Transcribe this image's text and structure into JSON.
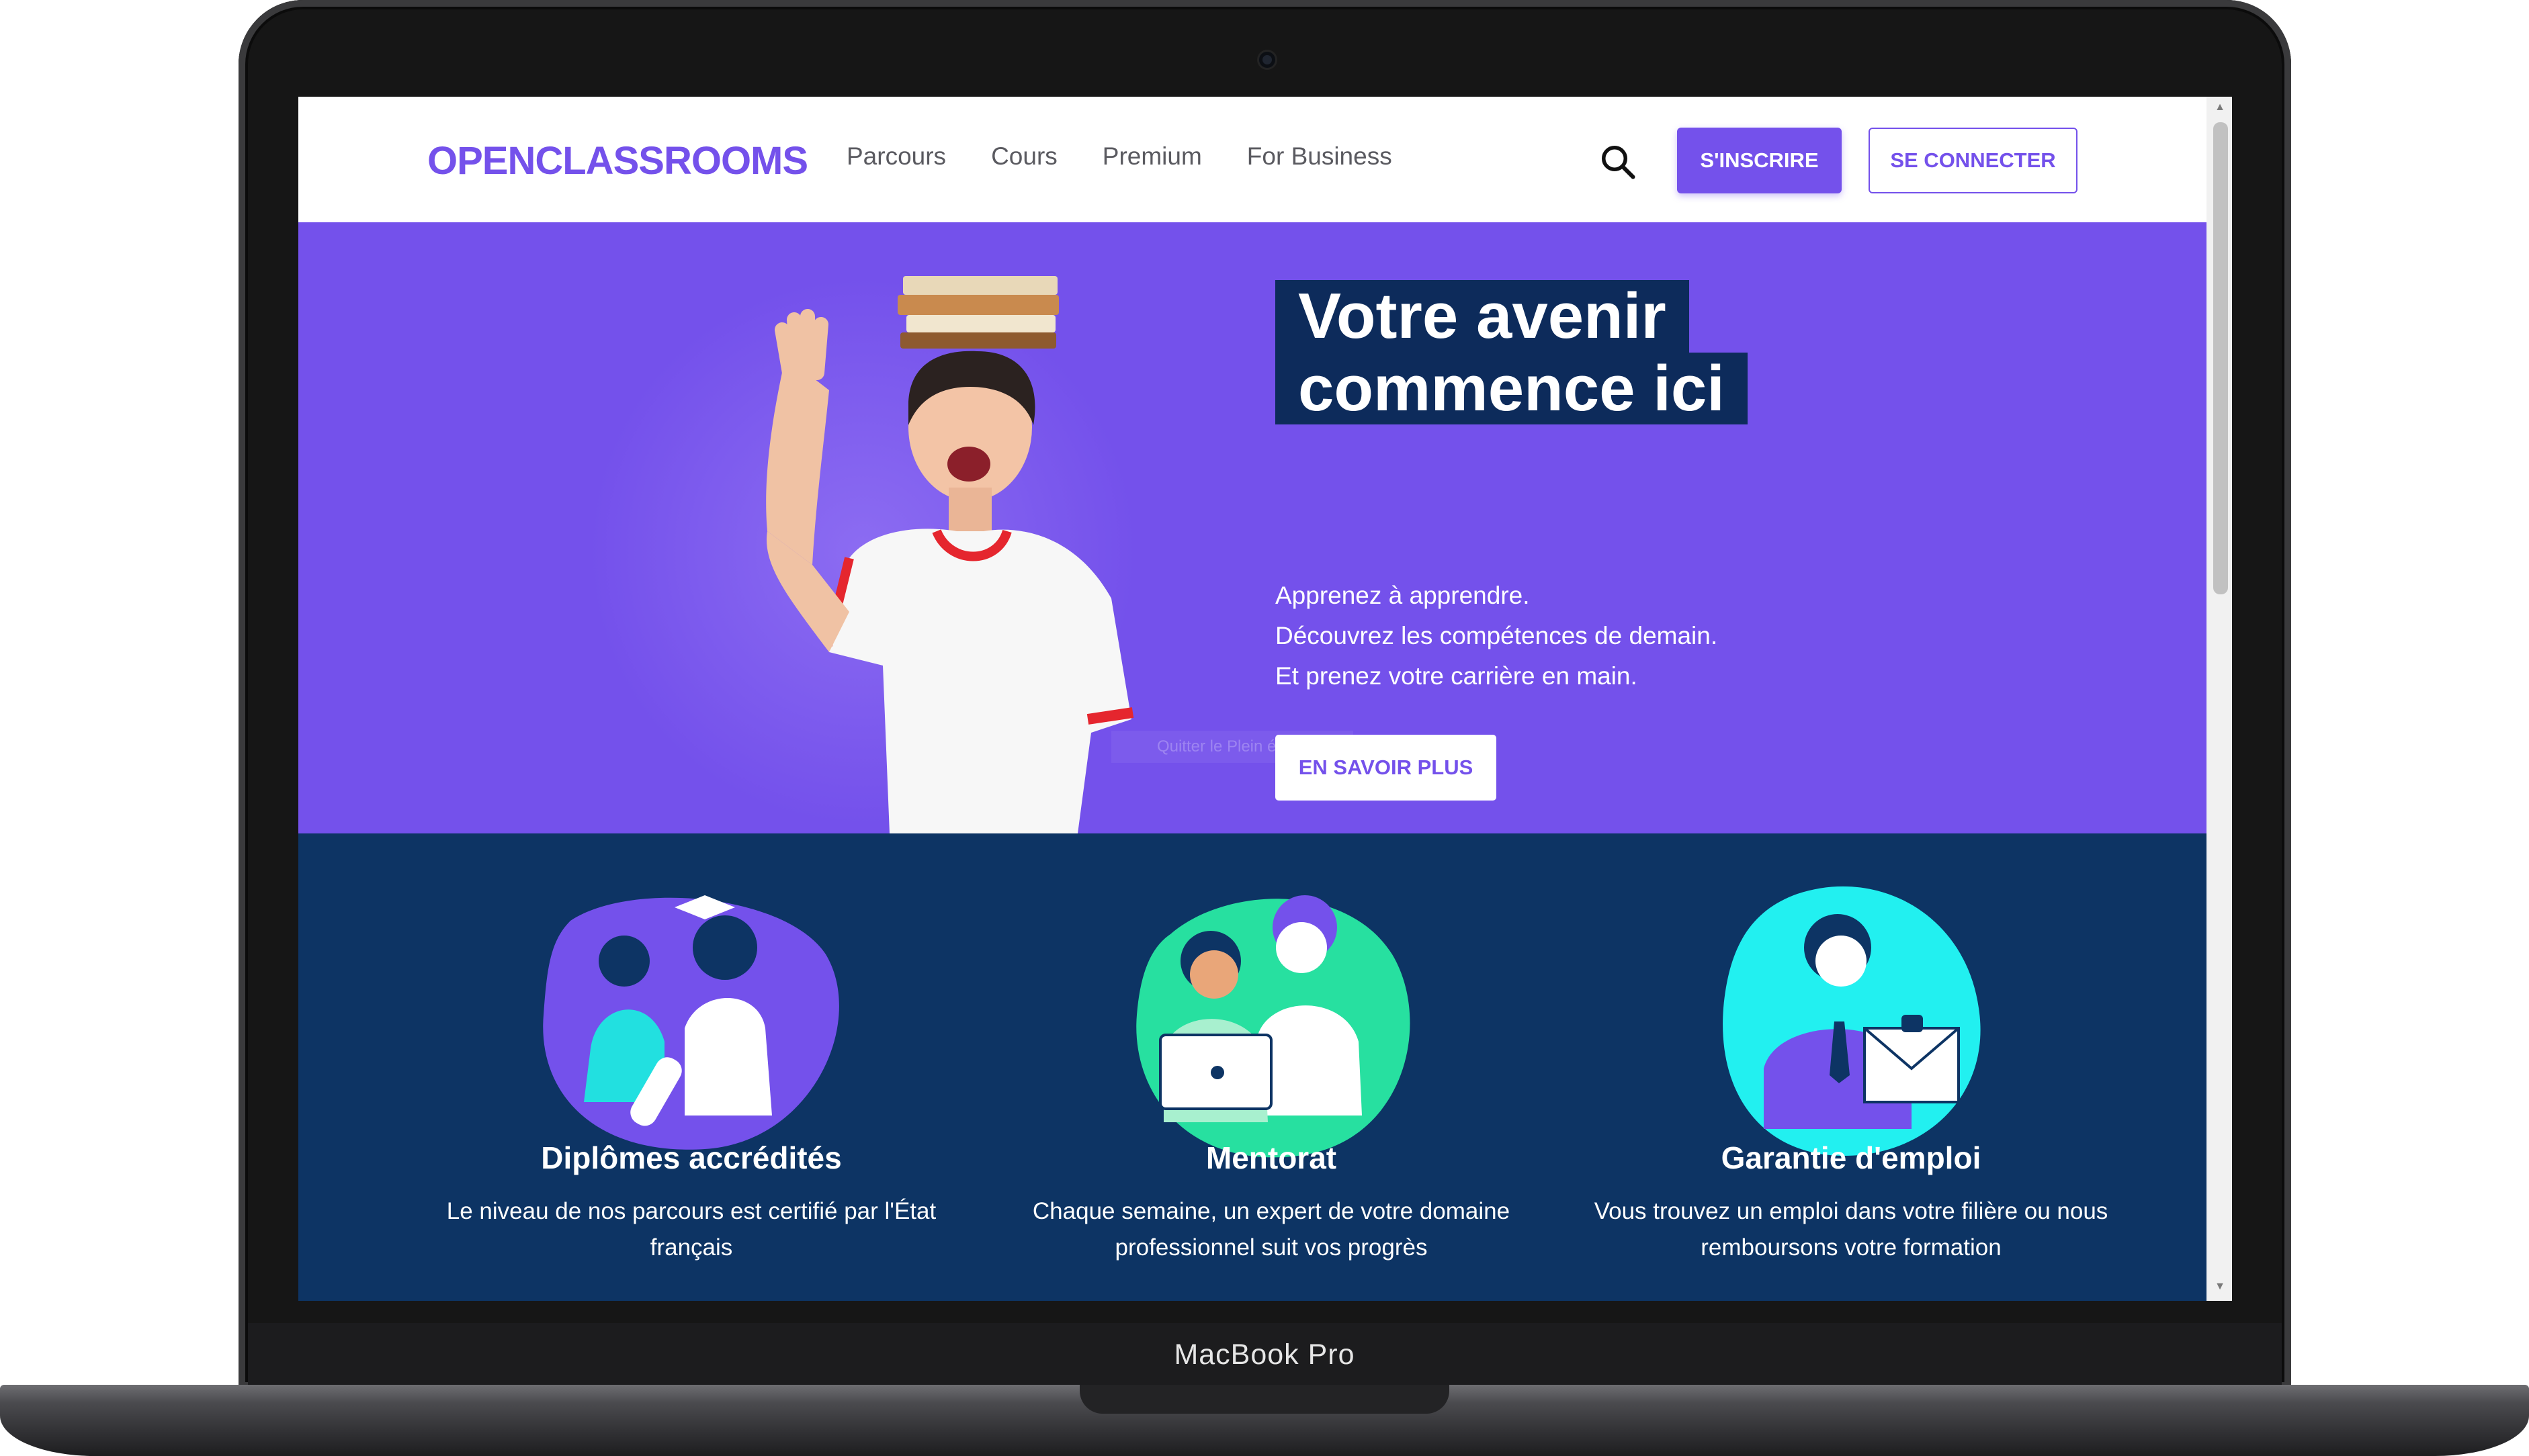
{
  "device": {
    "label": "MacBook Pro"
  },
  "navbar": {
    "logo": "OPENCLASSROOMS",
    "links": [
      "Parcours",
      "Cours",
      "Premium",
      "For Business"
    ],
    "search_icon": "search-icon",
    "register_label": "S'INSCRIRE",
    "login_label": "SE CONNECTER"
  },
  "hero": {
    "title_line1": "Votre avenir",
    "title_line2": "commence ici",
    "subtitle_lines": [
      "Apprenez à apprendre.",
      "Découvrez les compétences de demain.",
      "Et prenez votre carrière en main."
    ],
    "cta_label": "EN SAVOIR PLUS",
    "overlay_hint": "Quitter le Plein écran"
  },
  "features": [
    {
      "title": "Diplômes accrédités",
      "desc": "Le niveau de nos parcours est certifié par l'État français",
      "illus_color": "#7451eb"
    },
    {
      "title": "Mentorat",
      "desc": "Chaque semaine, un expert de votre domaine professionnel suit vos progrès",
      "illus_color": "#27e0a0"
    },
    {
      "title": "Garantie d'emploi",
      "desc": "Vous trouvez un emploi dans votre filière ou nous remboursons votre formation",
      "illus_color": "#22f0f0"
    }
  ],
  "colors": {
    "brand_purple": "#7451eb",
    "navy": "#0d3464",
    "title_box": "#0d2b5b"
  }
}
